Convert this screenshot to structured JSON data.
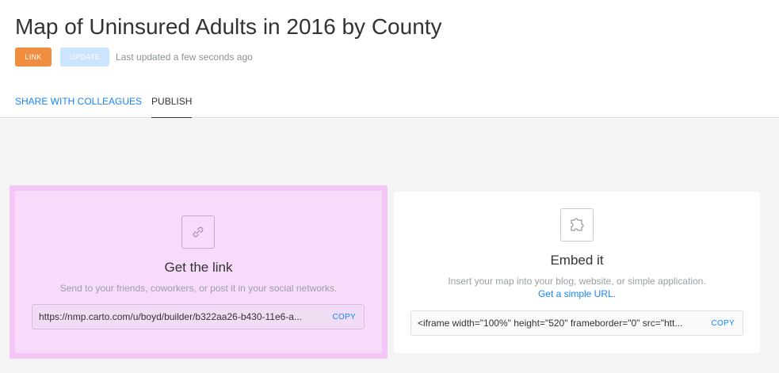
{
  "header": {
    "title": "Map of Uninsured Adults in 2016 by County",
    "badge_link": "LINK",
    "badge_update": "UPDATE",
    "last_updated": "Last updated a few seconds ago"
  },
  "tabs": [
    {
      "label": "SHARE WITH COLLEAGUES"
    },
    {
      "label": "PUBLISH"
    }
  ],
  "get_link": {
    "icon": "link-icon",
    "title": "Get the link",
    "description": "Send to your friends, coworkers, or post it in your social networks.",
    "url": "https://nmp.carto.com/u/boyd/builder/b322aa26-b430-11e6-a...",
    "copy_label": "COPY"
  },
  "embed": {
    "icon": "puzzle-icon",
    "title": "Embed it",
    "description": "Insert your map into your blog, website, or simple application.",
    "simple_url": "Get a simple URL.",
    "code": "<iframe width=\"100%\" height=\"520\" frameborder=\"0\" src=\"htt...",
    "copy_label": "COPY"
  },
  "colors": {
    "accent": "#1785fb",
    "link_badge": "#f08d3e",
    "update_badge": "#cbe5ff",
    "highlight": "#f8dafa"
  }
}
